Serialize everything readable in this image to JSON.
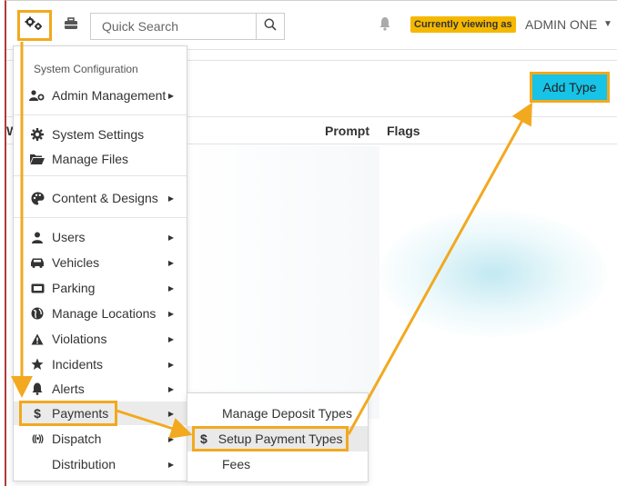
{
  "topbar": {
    "search_placeholder": "Quick Search",
    "viewing_badge": "Currently viewing as",
    "admin_name": "ADMIN ONE",
    "caret": "▼"
  },
  "page": {
    "add_type_label": "Add Type",
    "table_headers": {
      "first": "W",
      "prompt": "Prompt",
      "flags": "Flags"
    }
  },
  "menu": {
    "section_title": "System Configuration",
    "items": [
      {
        "label": "Admin Management",
        "icon": "users-cog-icon",
        "has_submenu": true
      },
      {
        "label": "System Settings",
        "icon": "gear-icon",
        "has_submenu": false
      },
      {
        "label": "Manage Files",
        "icon": "folder-open-icon",
        "has_submenu": false
      },
      {
        "label": "Content & Designs",
        "icon": "palette-icon",
        "has_submenu": true
      },
      {
        "label": "Users",
        "icon": "user-icon",
        "has_submenu": true
      },
      {
        "label": "Vehicles",
        "icon": "car-icon",
        "has_submenu": true
      },
      {
        "label": "Parking",
        "icon": "parking-icon",
        "has_submenu": true
      },
      {
        "label": "Manage Locations",
        "icon": "globe-icon",
        "has_submenu": true
      },
      {
        "label": "Violations",
        "icon": "warning-icon",
        "has_submenu": true
      },
      {
        "label": "Incidents",
        "icon": "star-icon",
        "has_submenu": true
      },
      {
        "label": "Alerts",
        "icon": "bell-icon",
        "has_submenu": true
      },
      {
        "label": "Payments",
        "icon": "dollar-icon",
        "has_submenu": true
      },
      {
        "label": "Dispatch",
        "icon": "broadcast-icon",
        "has_submenu": true
      },
      {
        "label": "Distribution",
        "icon": "",
        "has_submenu": true
      }
    ]
  },
  "submenu": {
    "items": [
      {
        "label": "Manage Deposit Types",
        "icon": ""
      },
      {
        "label": "Setup Payment Types",
        "icon": "dollar-icon"
      },
      {
        "label": "Fees",
        "icon": ""
      }
    ]
  },
  "colors": {
    "highlight_outline": "#f2a91f",
    "add_button": "#17c3e6",
    "badge": "#f5b800"
  }
}
